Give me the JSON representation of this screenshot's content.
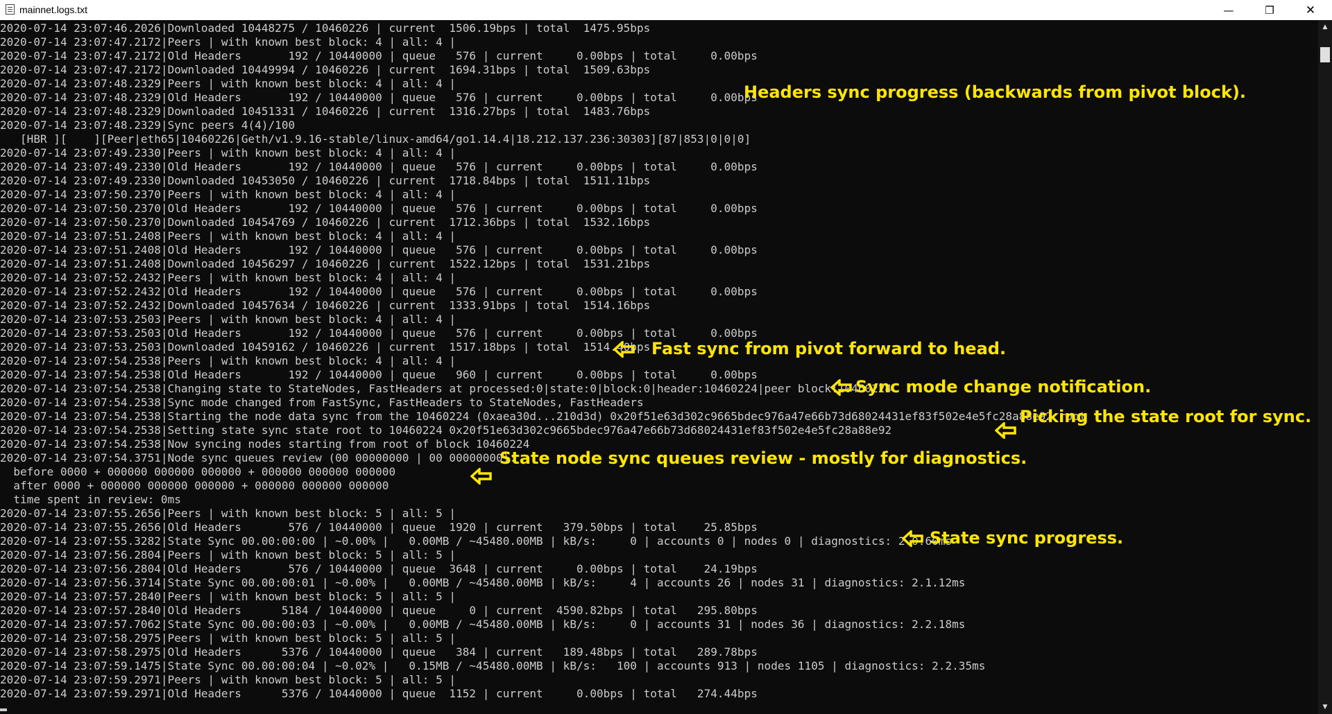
{
  "window": {
    "title": "mainnet.logs.txt",
    "minimize_glyph": "—",
    "restore_glyph": "❐",
    "close_glyph": "✕"
  },
  "scrollbar": {
    "up_glyph": "▲",
    "down_glyph": "▼"
  },
  "log_lines": [
    "2020-07-14 23:07:46.2026|Downloaded 10448275 / 10460226 | current  1506.19bps | total  1475.95bps",
    "2020-07-14 23:07:47.2172|Peers | with known best block: 4 | all: 4 |",
    "2020-07-14 23:07:47.2172|Old Headers       192 / 10440000 | queue   576 | current     0.00bps | total     0.00bps",
    "2020-07-14 23:07:47.2172|Downloaded 10449994 / 10460226 | current  1694.31bps | total  1509.63bps",
    "2020-07-14 23:07:48.2329|Peers | with known best block: 4 | all: 4 |",
    "2020-07-14 23:07:48.2329|Old Headers       192 / 10440000 | queue   576 | current     0.00bps | total     0.00bps",
    "2020-07-14 23:07:48.2329|Downloaded 10451331 / 10460226 | current  1316.27bps | total  1483.76bps",
    "2020-07-14 23:07:48.2329|Sync peers 4(4)/100",
    "   [HBR ][    ][Peer|eth65|10460226|Geth/v1.9.16-stable/linux-amd64/go1.14.4|18.212.137.236:30303][87|853|0|0|0]",
    "2020-07-14 23:07:49.2330|Peers | with known best block: 4 | all: 4 |",
    "2020-07-14 23:07:49.2330|Old Headers       192 / 10440000 | queue   576 | current     0.00bps | total     0.00bps",
    "2020-07-14 23:07:49.2330|Downloaded 10453050 / 10460226 | current  1718.84bps | total  1511.11bps",
    "2020-07-14 23:07:50.2370|Peers | with known best block: 4 | all: 4 |",
    "2020-07-14 23:07:50.2370|Old Headers       192 / 10440000 | queue   576 | current     0.00bps | total     0.00bps",
    "2020-07-14 23:07:50.2370|Downloaded 10454769 / 10460226 | current  1712.36bps | total  1532.16bps",
    "2020-07-14 23:07:51.2408|Peers | with known best block: 4 | all: 4 |",
    "2020-07-14 23:07:51.2408|Old Headers       192 / 10440000 | queue   576 | current     0.00bps | total     0.00bps",
    "2020-07-14 23:07:51.2408|Downloaded 10456297 / 10460226 | current  1522.12bps | total  1531.21bps",
    "2020-07-14 23:07:52.2432|Peers | with known best block: 4 | all: 4 |",
    "2020-07-14 23:07:52.2432|Old Headers       192 / 10440000 | queue   576 | current     0.00bps | total     0.00bps",
    "2020-07-14 23:07:52.2432|Downloaded 10457634 / 10460226 | current  1333.91bps | total  1514.16bps",
    "2020-07-14 23:07:53.2503|Peers | with known best block: 4 | all: 4 |",
    "2020-07-14 23:07:53.2503|Old Headers       192 / 10440000 | queue   576 | current     0.00bps | total     0.00bps",
    "2020-07-14 23:07:53.2503|Downloaded 10459162 / 10460226 | current  1517.18bps | total  1514.40bps",
    "2020-07-14 23:07:54.2538|Peers | with known best block: 4 | all: 4 |",
    "2020-07-14 23:07:54.2538|Old Headers       192 / 10440000 | queue   960 | current     0.00bps | total     0.00bps",
    "2020-07-14 23:07:54.2538|Changing state to StateNodes, FastHeaders at processed:0|state:0|block:0|header:10460224|peer block:10460224",
    "2020-07-14 23:07:54.2538|Sync mode changed from FastSync, FastHeaders to StateNodes, FastHeaders",
    "2020-07-14 23:07:54.2538|Starting the node data sync from the 10460224 (0xaea30d...210d3d) 0x20f51e63d302c9665bdec976a47e66b73d68024431ef83f502e4e5fc28a88e92 root",
    "2020-07-14 23:07:54.2538|Setting state sync state root to 10460224 0x20f51e63d302c9665bdec976a47e66b73d68024431ef83f502e4e5fc28a88e92",
    "2020-07-14 23:07:54.2538|Now syncing nodes starting from root of block 10460224",
    "2020-07-14 23:07:54.3751|Node sync queues review (00 00000000 | 00 00000000):",
    "  before 0000 + 000000 000000 000000 + 000000 000000 000000",
    "  after 0000 + 000000 000000 000000 + 000000 000000 000000",
    "  time spent in review: 0ms",
    "2020-07-14 23:07:55.2656|Peers | with known best block: 5 | all: 5 |",
    "2020-07-14 23:07:55.2656|Old Headers       576 / 10440000 | queue  1920 | current   379.50bps | total    25.85bps",
    "2020-07-14 23:07:55.3282|State Sync 00.00:00:00 | ~0.00% |   0.00MB / ~45480.00MB | kB/s:     0 | accounts 0 | nodes 0 | diagnostics: 2.0.60ms",
    "2020-07-14 23:07:56.2804|Peers | with known best block: 5 | all: 5 |",
    "2020-07-14 23:07:56.2804|Old Headers       576 / 10440000 | queue  3648 | current     0.00bps | total    24.19bps",
    "2020-07-14 23:07:56.3714|State Sync 00.00:00:01 | ~0.00% |   0.00MB / ~45480.00MB | kB/s:     4 | accounts 26 | nodes 31 | diagnostics: 2.1.12ms",
    "2020-07-14 23:07:57.2840|Peers | with known best block: 5 | all: 5 |",
    "2020-07-14 23:07:57.2840|Old Headers      5184 / 10440000 | queue     0 | current  4590.82bps | total   295.80bps",
    "2020-07-14 23:07:57.7062|State Sync 00.00:00:03 | ~0.00% |   0.00MB / ~45480.00MB | kB/s:     0 | accounts 31 | nodes 36 | diagnostics: 2.2.18ms",
    "2020-07-14 23:07:58.2975|Peers | with known best block: 5 | all: 5 |",
    "2020-07-14 23:07:58.2975|Old Headers      5376 / 10440000 | queue   384 | current   189.48bps | total   289.78bps",
    "2020-07-14 23:07:59.1475|State Sync 00.00:00:04 | ~0.02% |   0.15MB / ~45480.00MB | kB/s:   100 | accounts 913 | nodes 1105 | diagnostics: 2.2.35ms",
    "2020-07-14 23:07:59.2971|Peers | with known best block: 5 | all: 5 |",
    "2020-07-14 23:07:59.2971|Old Headers      5376 / 10440000 | queue  1152 | current     0.00bps | total   274.44bps"
  ],
  "annotations": [
    {
      "text": "Headers sync progress (backwards from pivot block).",
      "arrow": false
    },
    {
      "text": "Fast sync from pivot forward to head.",
      "arrow": true
    },
    {
      "text": "Sync mode change notification.",
      "arrow": true
    },
    {
      "text": "Picking the state root for sync.",
      "arrow": true
    },
    {
      "text": "State node sync queues review - mostly for diagnostics.",
      "arrow": true
    },
    {
      "text": "State sync progress.",
      "arrow": true
    }
  ],
  "colors": {
    "background": "#0c0c0c",
    "log_text": "#cccccc",
    "annotation": "#ffe600"
  }
}
